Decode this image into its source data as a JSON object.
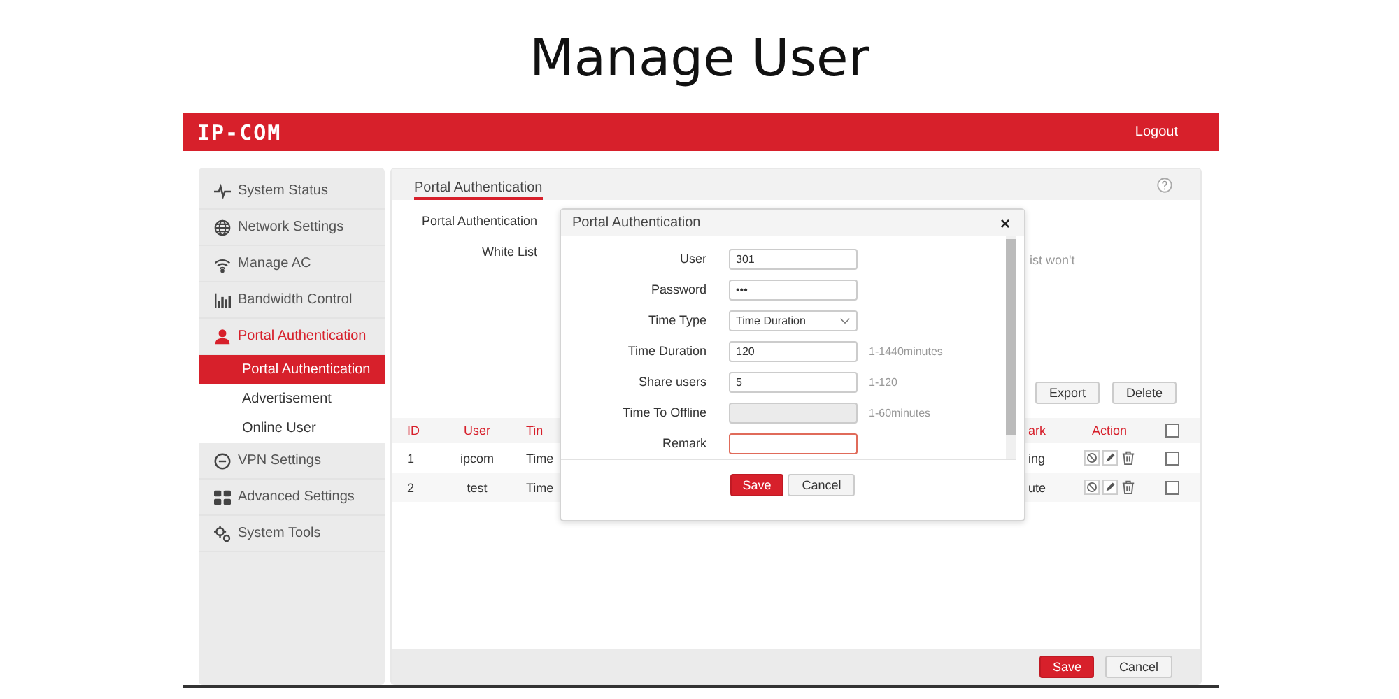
{
  "page_title": "Manage User",
  "header": {
    "logo": "IP-COM",
    "logout": "Logout"
  },
  "sidebar": {
    "items": [
      {
        "label": "System Status",
        "selected": false
      },
      {
        "label": "Network Settings",
        "selected": false
      },
      {
        "label": "Manage AC",
        "selected": false
      },
      {
        "label": "Bandwidth Control",
        "selected": false
      },
      {
        "label": "Portal Authentication",
        "selected": true,
        "children": [
          {
            "label": "Portal Authentication",
            "selected": true
          },
          {
            "label": "Advertisement",
            "selected": false
          },
          {
            "label": "Online User",
            "selected": false
          }
        ]
      },
      {
        "label": "VPN Settings",
        "selected": false
      },
      {
        "label": "Advanced Settings",
        "selected": false
      },
      {
        "label": "System Tools",
        "selected": false
      }
    ]
  },
  "main": {
    "tab": {
      "label": "Portal Authentication",
      "selected": true
    },
    "form_labels": [
      "Portal Authentication",
      "White List"
    ],
    "note": "ist won't",
    "toolbar": [
      "Export",
      "Delete"
    ],
    "table": {
      "columns": [
        "ID",
        "User",
        "Tin",
        "ark",
        "Action"
      ],
      "all_checked": false,
      "rows": [
        {
          "cells": [
            "1",
            "ipcom",
            "Time",
            "ing"
          ],
          "checked": false
        },
        {
          "cells": [
            "2",
            "test",
            "Time",
            "ute"
          ],
          "checked": false
        }
      ]
    },
    "footer": {
      "save": "Save",
      "cancel": "Cancel"
    }
  },
  "modal": {
    "title": "Portal Authentication",
    "close": "×",
    "fields": [
      {
        "label": "User",
        "kind": "text",
        "value": "301"
      },
      {
        "label": "Password",
        "kind": "text",
        "value": "•••"
      },
      {
        "label": "Time Type",
        "kind": "select",
        "value": "Time Duration"
      },
      {
        "label": "Time Duration",
        "kind": "text",
        "value": "120",
        "hint": "1-1440minutes"
      },
      {
        "label": "Share users",
        "kind": "text",
        "value": "5",
        "hint": "1-120"
      },
      {
        "label": "Time To Offline",
        "kind": "text",
        "disabled": true,
        "hint": "1-60minutes"
      },
      {
        "label": "Remark",
        "kind": "text",
        "focused": true
      }
    ],
    "save": "Save",
    "cancel": "Cancel"
  }
}
